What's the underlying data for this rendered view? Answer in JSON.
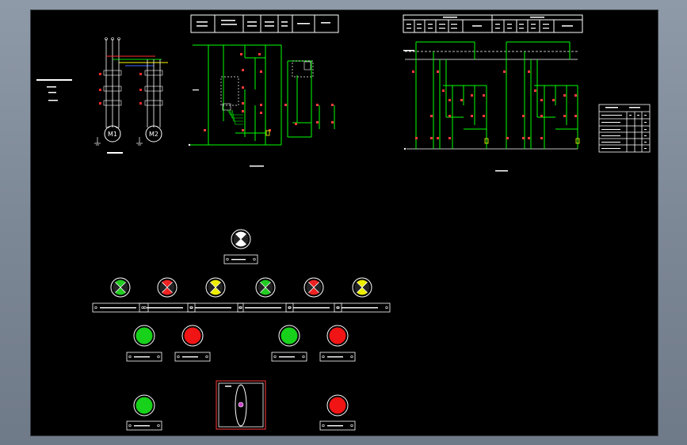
{
  "colors": {
    "wire": "#00ff00",
    "contact": "#ff3b3b",
    "line": "#ffffff",
    "phase_red": "#ff2a2a",
    "phase_green": "#00dd00",
    "phase_yellow": "#ffff00",
    "phase_blue": "#3b6bff",
    "lamp_green": "#22cc22",
    "lamp_red": "#ee2222",
    "lamp_yellow": "#eeee00",
    "lamp_white": "#ffffff",
    "button_green": "#17d11a",
    "button_red": "#f01414"
  },
  "motors": [
    {
      "label": "M1"
    },
    {
      "label": "M2"
    }
  ],
  "panel": {
    "power_lamp": {
      "color": "white"
    },
    "lamps": [
      {
        "color": "green"
      },
      {
        "color": "red"
      },
      {
        "color": "yellow"
      },
      {
        "color": "green"
      },
      {
        "color": "red"
      },
      {
        "color": "yellow"
      }
    ],
    "buttons_row1": [
      {
        "color": "green"
      },
      {
        "color": "red"
      },
      {
        "color": "green"
      },
      {
        "color": "red"
      }
    ],
    "bottom_left_button": {
      "color": "green"
    },
    "bottom_right_button": {
      "color": "red"
    }
  },
  "icons": {
    "indicator_lamp": "lamp-x-icon",
    "push_button": "round-button-icon",
    "selector_switch": "selector-switch-icon",
    "motor": "motor-circle-icon"
  }
}
